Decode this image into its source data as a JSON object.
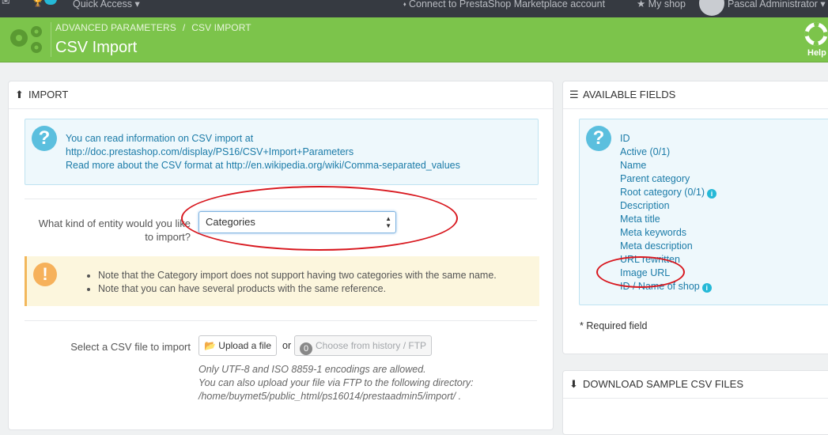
{
  "topbar": {
    "quick_access": "Quick Access ▾",
    "connect": "⬪ Connect to PrestaShop Marketplace account",
    "my_shop": "★ My shop",
    "user": "Pascal Administrator ▾"
  },
  "header": {
    "breadcrumb": [
      "ADVANCED PARAMETERS",
      "CSV IMPORT"
    ],
    "title": "CSV Import",
    "help_label": "Help"
  },
  "import_panel": {
    "heading": "IMPORT",
    "info_lines": [
      "You can read information on CSV import at",
      "http://doc.prestashop.com/display/PS16/CSV+Import+Parameters",
      "Read more about the CSV format at http://en.wikipedia.org/wiki/Comma-separated_values"
    ],
    "entity_label_line1": "What kind of entity would you like",
    "entity_label_line2": "to import?",
    "entity_value": "Categories",
    "warnings": [
      "Note that the Category import does not support having two categories with the same name.",
      "Note that you can have several products with the same reference."
    ],
    "file_label": "Select a CSV file to import",
    "upload_button": "Upload a file",
    "or_text": "or",
    "history_count": "0",
    "history_button": "Choose from history / FTP",
    "help_lines": [
      "Only UTF-8 and ISO 8859-1 encodings are allowed.",
      "You can also upload your file via FTP to the following directory:",
      "/home/buymet5/public_html/ps16014/prestaadmin5/import/ ."
    ]
  },
  "fields_panel": {
    "heading": "AVAILABLE FIELDS",
    "fields": [
      "ID",
      "Active (0/1)",
      "Name",
      "Parent category",
      "Root category (0/1)",
      "Description",
      "Meta title",
      "Meta keywords",
      "Meta description",
      "URL rewritten",
      "Image URL",
      "ID / Name of shop"
    ],
    "required_note": "* Required field"
  },
  "download_panel": {
    "heading": "DOWNLOAD SAMPLE CSV FILES"
  },
  "colors": {
    "header_green": "#7cc44b",
    "topbar": "#363a41",
    "link_blue": "#1b7ba8",
    "annotation_red": "#d8171e"
  }
}
